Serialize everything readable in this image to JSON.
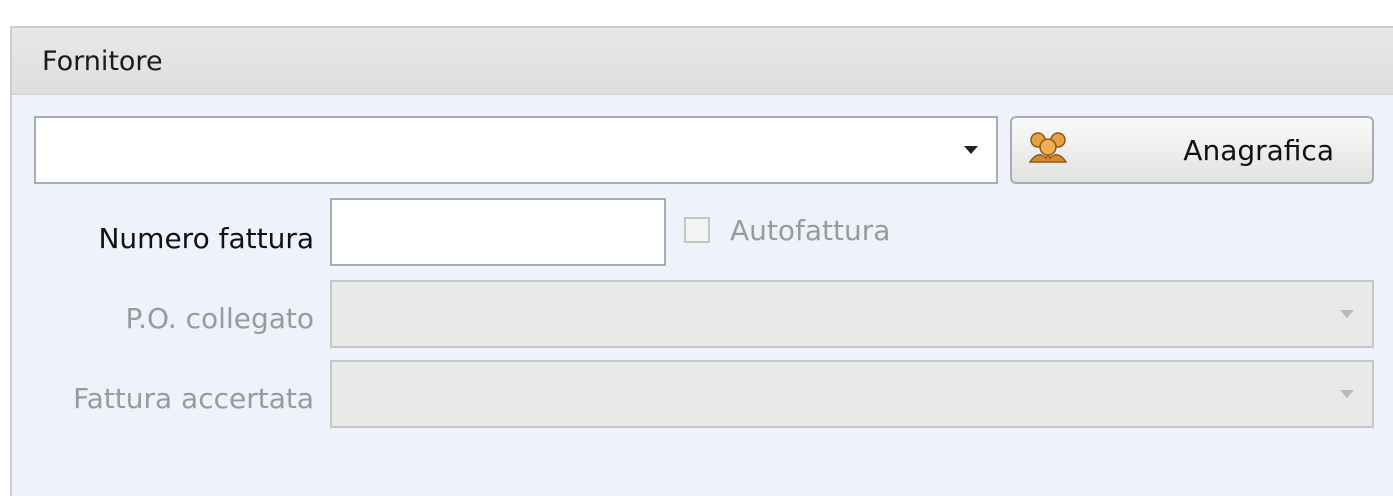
{
  "panel": {
    "title": "Fornitore"
  },
  "supplier": {
    "selected_value": "",
    "button_label": "Anagrafica",
    "button_icon": "users-group-icon"
  },
  "invoice": {
    "number_label": "Numero fattura",
    "number_value": "",
    "self_invoice_label": "Autofattura",
    "self_invoice_checked": false
  },
  "po": {
    "label": "P.O. collegato",
    "selected_value": ""
  },
  "verified_invoice": {
    "label": "Fattura accertata",
    "selected_value": ""
  },
  "colors": {
    "panel_bg": "#eef2fb",
    "header_bg": "#e3e3e3",
    "disabled_text": "#9a9a9a"
  }
}
